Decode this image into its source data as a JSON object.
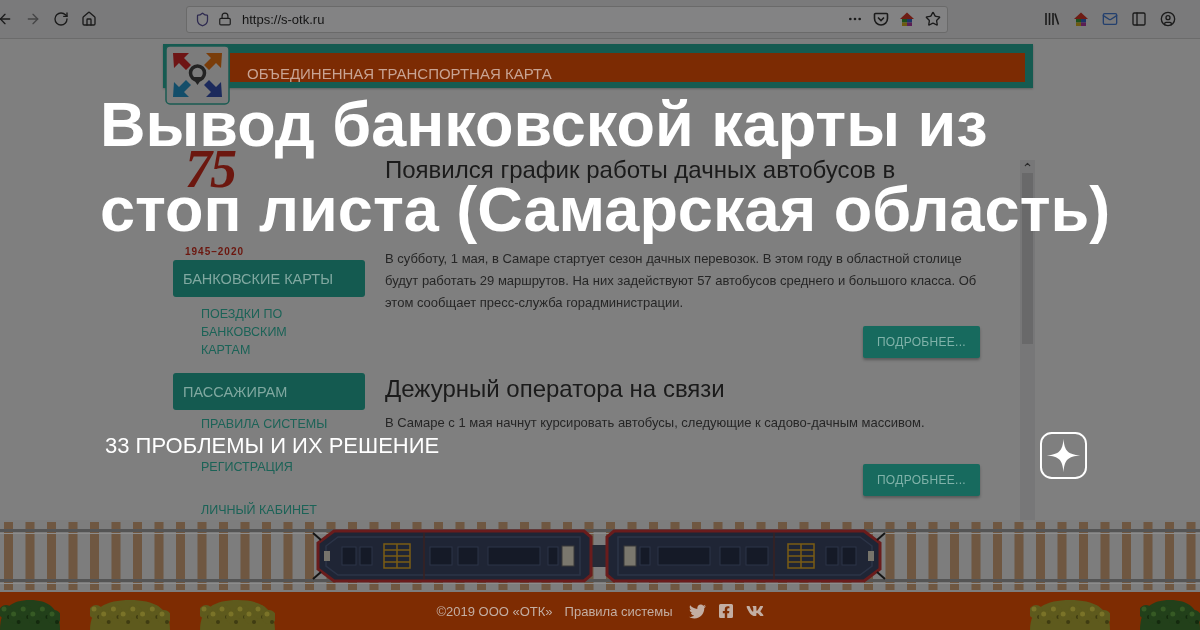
{
  "browser": {
    "url": "https://s-otk.ru"
  },
  "site": {
    "header": {
      "title": "ОБЪЕДИНЕННАЯ ТРАНСПОРТНАЯ КАРТА"
    },
    "sidebar": {
      "anniversary_logo": {
        "number": "75",
        "years": "1945–2020"
      },
      "sections": [
        {
          "title": "БАНКОВСКИЕ КАРТЫ",
          "links": [
            "ПОЕЗДКИ ПО БАНКОВСКИМ КАРТАМ"
          ]
        },
        {
          "title": "ПАССАЖИРАМ",
          "links": [
            "ПРАВИЛА СИСТЕМЫ",
            "РЕГИСТРАЦИЯ",
            "ЛИЧНЫЙ КАБИНЕТ"
          ]
        }
      ]
    },
    "news": [
      {
        "title": "Появился график работы дачных автобусов в",
        "text": "В субботу, 1 мая, в Самаре стартует сезон дачных перевозок. В этом году в областной столице будут работать 29 маршрутов. На них задействуют 57 автобусов среднего и большого класса. Об этом сообщает пресс-служба горадминистрации.",
        "button": "ПОДРОБНЕЕ..."
      },
      {
        "title": "Дежурный оператора на связи",
        "text": "В Самаре с 1 мая начнут курсировать автобусы, следующие к садово-дачным массивом.",
        "button": "ПОДРОБНЕЕ..."
      }
    ],
    "footer": {
      "copyright": "©2019 ООО «ОТК»",
      "link": "Правила системы"
    }
  },
  "article": {
    "title_lines": [
      "Вывод банковской карты из",
      "стоп листа (Самарская область)"
    ],
    "channel": "33 ПРОБЛЕМЫ И ИХ РЕШЕНИЕ"
  }
}
